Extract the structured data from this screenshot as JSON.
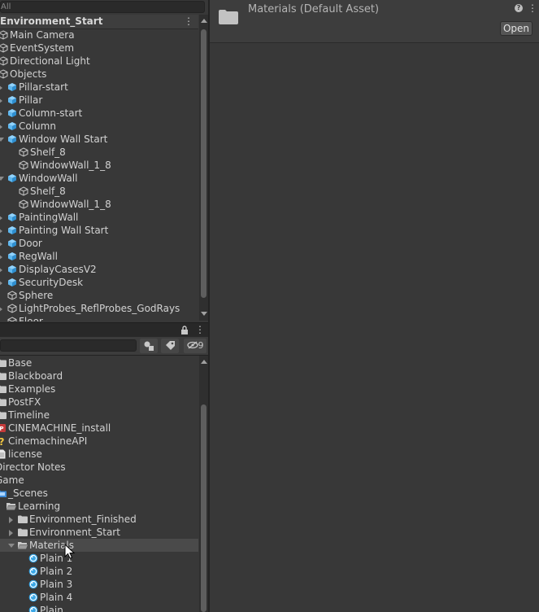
{
  "hierarchy": {
    "search_placeholder": "All",
    "scene_name": "Environment_Start",
    "scene_menu": "⋮",
    "items": [
      {
        "label": "Main Camera",
        "icon": "gameobject-icon",
        "depth": 0,
        "arrow": "none"
      },
      {
        "label": "EventSystem",
        "icon": "gameobject-icon",
        "depth": 0,
        "arrow": "none"
      },
      {
        "label": "Directional Light",
        "icon": "gameobject-icon",
        "depth": 0,
        "arrow": "none"
      },
      {
        "label": "Objects",
        "icon": "gameobject-icon",
        "depth": 0,
        "arrow": "none"
      },
      {
        "label": "Pillar-start",
        "icon": "prefab-icon",
        "depth": 1,
        "arrow": "collapsed"
      },
      {
        "label": "Pillar",
        "icon": "prefab-icon",
        "depth": 1,
        "arrow": "collapsed"
      },
      {
        "label": "Column-start",
        "icon": "prefab-icon",
        "depth": 1,
        "arrow": "collapsed"
      },
      {
        "label": "Column",
        "icon": "prefab-icon",
        "depth": 1,
        "arrow": "collapsed"
      },
      {
        "label": "Window Wall Start",
        "icon": "prefab-icon",
        "depth": 1,
        "arrow": "expanded"
      },
      {
        "label": "Shelf_8",
        "icon": "gameobject-icon",
        "depth": 2,
        "arrow": "none"
      },
      {
        "label": "WindowWall_1_8",
        "icon": "gameobject-icon",
        "depth": 2,
        "arrow": "none"
      },
      {
        "label": "WindowWall",
        "icon": "prefab-icon",
        "depth": 1,
        "arrow": "expanded"
      },
      {
        "label": "Shelf_8",
        "icon": "gameobject-icon",
        "depth": 2,
        "arrow": "none"
      },
      {
        "label": "WindowWall_1_8",
        "icon": "gameobject-icon",
        "depth": 2,
        "arrow": "none"
      },
      {
        "label": "PaintingWall",
        "icon": "prefab-icon",
        "depth": 1,
        "arrow": "collapsed"
      },
      {
        "label": "Painting Wall Start",
        "icon": "prefab-icon",
        "depth": 1,
        "arrow": "collapsed"
      },
      {
        "label": "Door",
        "icon": "prefab-icon",
        "depth": 1,
        "arrow": "collapsed"
      },
      {
        "label": "RegWall",
        "icon": "prefab-icon",
        "depth": 1,
        "arrow": "collapsed"
      },
      {
        "label": "DisplayCasesV2",
        "icon": "prefab-icon",
        "depth": 1,
        "arrow": "collapsed"
      },
      {
        "label": "SecurityDesk",
        "icon": "prefab-icon",
        "depth": 1,
        "arrow": "collapsed"
      },
      {
        "label": "Sphere",
        "icon": "gameobject-icon",
        "depth": 1,
        "arrow": "none"
      },
      {
        "label": "LightProbes_ReflProbes_GodRays",
        "icon": "gameobject-icon",
        "depth": 1,
        "arrow": "collapsed"
      },
      {
        "label": "Floor",
        "icon": "gameobject-icon",
        "depth": 1,
        "arrow": "none"
      }
    ]
  },
  "project": {
    "lock_icon": "lock-icon",
    "menu": "⋮",
    "hidden_count": "9",
    "items": [
      {
        "label": "Base",
        "icon": "folder-icon",
        "depth": 0,
        "arrow": "none",
        "selected": false
      },
      {
        "label": "Blackboard",
        "icon": "folder-icon",
        "depth": 0,
        "arrow": "none",
        "selected": false
      },
      {
        "label": "Examples",
        "icon": "folder-icon",
        "depth": 0,
        "arrow": "none",
        "selected": false
      },
      {
        "label": "PostFX",
        "icon": "folder-icon",
        "depth": 0,
        "arrow": "none",
        "selected": false
      },
      {
        "label": "Timeline",
        "icon": "folder-icon",
        "depth": 0,
        "arrow": "none",
        "selected": false
      },
      {
        "label": "CINEMACHINE_install",
        "icon": "package-icon",
        "depth": 0,
        "arrow": "none",
        "selected": false
      },
      {
        "label": "CinemachineAPI",
        "icon": "question-icon",
        "depth": 0,
        "arrow": "none",
        "selected": false
      },
      {
        "label": "license",
        "icon": "file-icon",
        "depth": 0,
        "arrow": "none",
        "selected": false
      },
      {
        "label": "Director Notes",
        "icon": "none",
        "depth": -1,
        "arrow": "none",
        "selected": false
      },
      {
        "label": "Game",
        "icon": "none",
        "depth": -1,
        "arrow": "none",
        "selected": false
      },
      {
        "label": "_Scenes",
        "icon": "scene-folder-icon",
        "depth": 0,
        "arrow": "none",
        "selected": false
      },
      {
        "label": "Learning",
        "icon": "open-folder-icon",
        "depth": 1,
        "arrow": "none",
        "selected": false
      },
      {
        "label": "Environment_Finished",
        "icon": "folder-icon",
        "depth": 2,
        "arrow": "collapsed",
        "selected": false
      },
      {
        "label": "Environment_Start",
        "icon": "folder-icon",
        "depth": 2,
        "arrow": "collapsed",
        "selected": false
      },
      {
        "label": "Materials",
        "icon": "open-folder-icon",
        "depth": 2,
        "arrow": "expanded",
        "selected": true
      },
      {
        "label": "Plain 1",
        "icon": "material-icon",
        "depth": 3,
        "arrow": "none",
        "selected": false
      },
      {
        "label": "Plain 2",
        "icon": "material-icon",
        "depth": 3,
        "arrow": "none",
        "selected": false
      },
      {
        "label": "Plain 3",
        "icon": "material-icon",
        "depth": 3,
        "arrow": "none",
        "selected": false
      },
      {
        "label": "Plain 4",
        "icon": "material-icon",
        "depth": 3,
        "arrow": "none",
        "selected": false
      },
      {
        "label": "Plain",
        "icon": "material-icon",
        "depth": 3,
        "arrow": "none",
        "selected": false
      }
    ]
  },
  "inspector": {
    "title": "Materials (Default Asset)",
    "open_label": "Open",
    "help_icon": "help-icon",
    "menu": "⋮"
  },
  "colors": {
    "prefab": "#5fb8f0",
    "material": "#3aa7e6",
    "folder": "#c9c9c9",
    "background": "#383838"
  }
}
